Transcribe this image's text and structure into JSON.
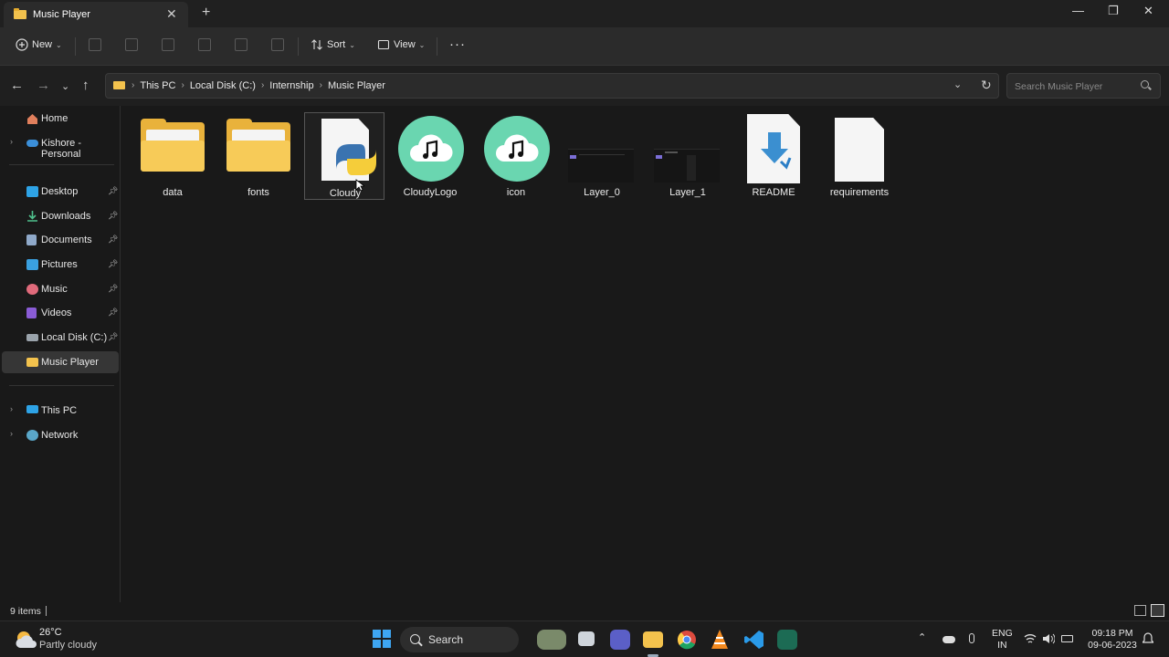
{
  "window": {
    "tab_title": "Music Player",
    "close_glyph": "✕",
    "newtab_glyph": "+",
    "minimize_glyph": "—",
    "maximize_glyph": "❐",
    "winclose_glyph": "✕"
  },
  "toolbar": {
    "new_label": "New",
    "sort_label": "Sort",
    "view_label": "View",
    "more_glyph": "···"
  },
  "address": {
    "crumbs": [
      "This PC",
      "Local Disk (C:)",
      "Internship",
      "Music Player"
    ],
    "search_placeholder": "Search Music Player"
  },
  "sidebar": {
    "items": [
      {
        "label": "Home",
        "icon": "home-icon"
      },
      {
        "label": "Kishore - Personal",
        "icon": "onedrive-icon"
      },
      {
        "label": "Desktop",
        "icon": "desktop-icon",
        "pinned": true
      },
      {
        "label": "Downloads",
        "icon": "downloads-icon",
        "pinned": true
      },
      {
        "label": "Documents",
        "icon": "documents-icon",
        "pinned": true
      },
      {
        "label": "Pictures",
        "icon": "pictures-icon",
        "pinned": true
      },
      {
        "label": "Music",
        "icon": "music-icon",
        "pinned": true
      },
      {
        "label": "Videos",
        "icon": "videos-icon",
        "pinned": true
      },
      {
        "label": "Local Disk (C:)",
        "icon": "drive-icon",
        "pinned": true
      },
      {
        "label": "Music Player",
        "icon": "folder-icon",
        "selected": true
      },
      {
        "label": "This PC",
        "icon": "this-pc-icon"
      },
      {
        "label": "Network",
        "icon": "network-icon"
      }
    ]
  },
  "files": [
    {
      "name": "data",
      "type": "folder"
    },
    {
      "name": "fonts",
      "type": "folder"
    },
    {
      "name": "Cloudy",
      "type": "python"
    },
    {
      "name": "CloudyLogo",
      "type": "image"
    },
    {
      "name": "icon",
      "type": "image"
    },
    {
      "name": "Layer_0",
      "type": "thumbnail"
    },
    {
      "name": "Layer_1",
      "type": "thumbnail"
    },
    {
      "name": "README",
      "type": "markdown"
    },
    {
      "name": "requirements",
      "type": "text"
    }
  ],
  "status": {
    "items_count": "9 items"
  },
  "taskbar": {
    "weather_temp": "26°C",
    "weather_desc": "Partly cloudy",
    "search_label": "Search",
    "lang_top": "ENG",
    "lang_bottom": "IN",
    "time": "09:18 PM",
    "date": "09-06-2023"
  },
  "colors": {
    "accent": "#6ad6b0",
    "folder": "#f3c24d",
    "background": "#191919"
  }
}
